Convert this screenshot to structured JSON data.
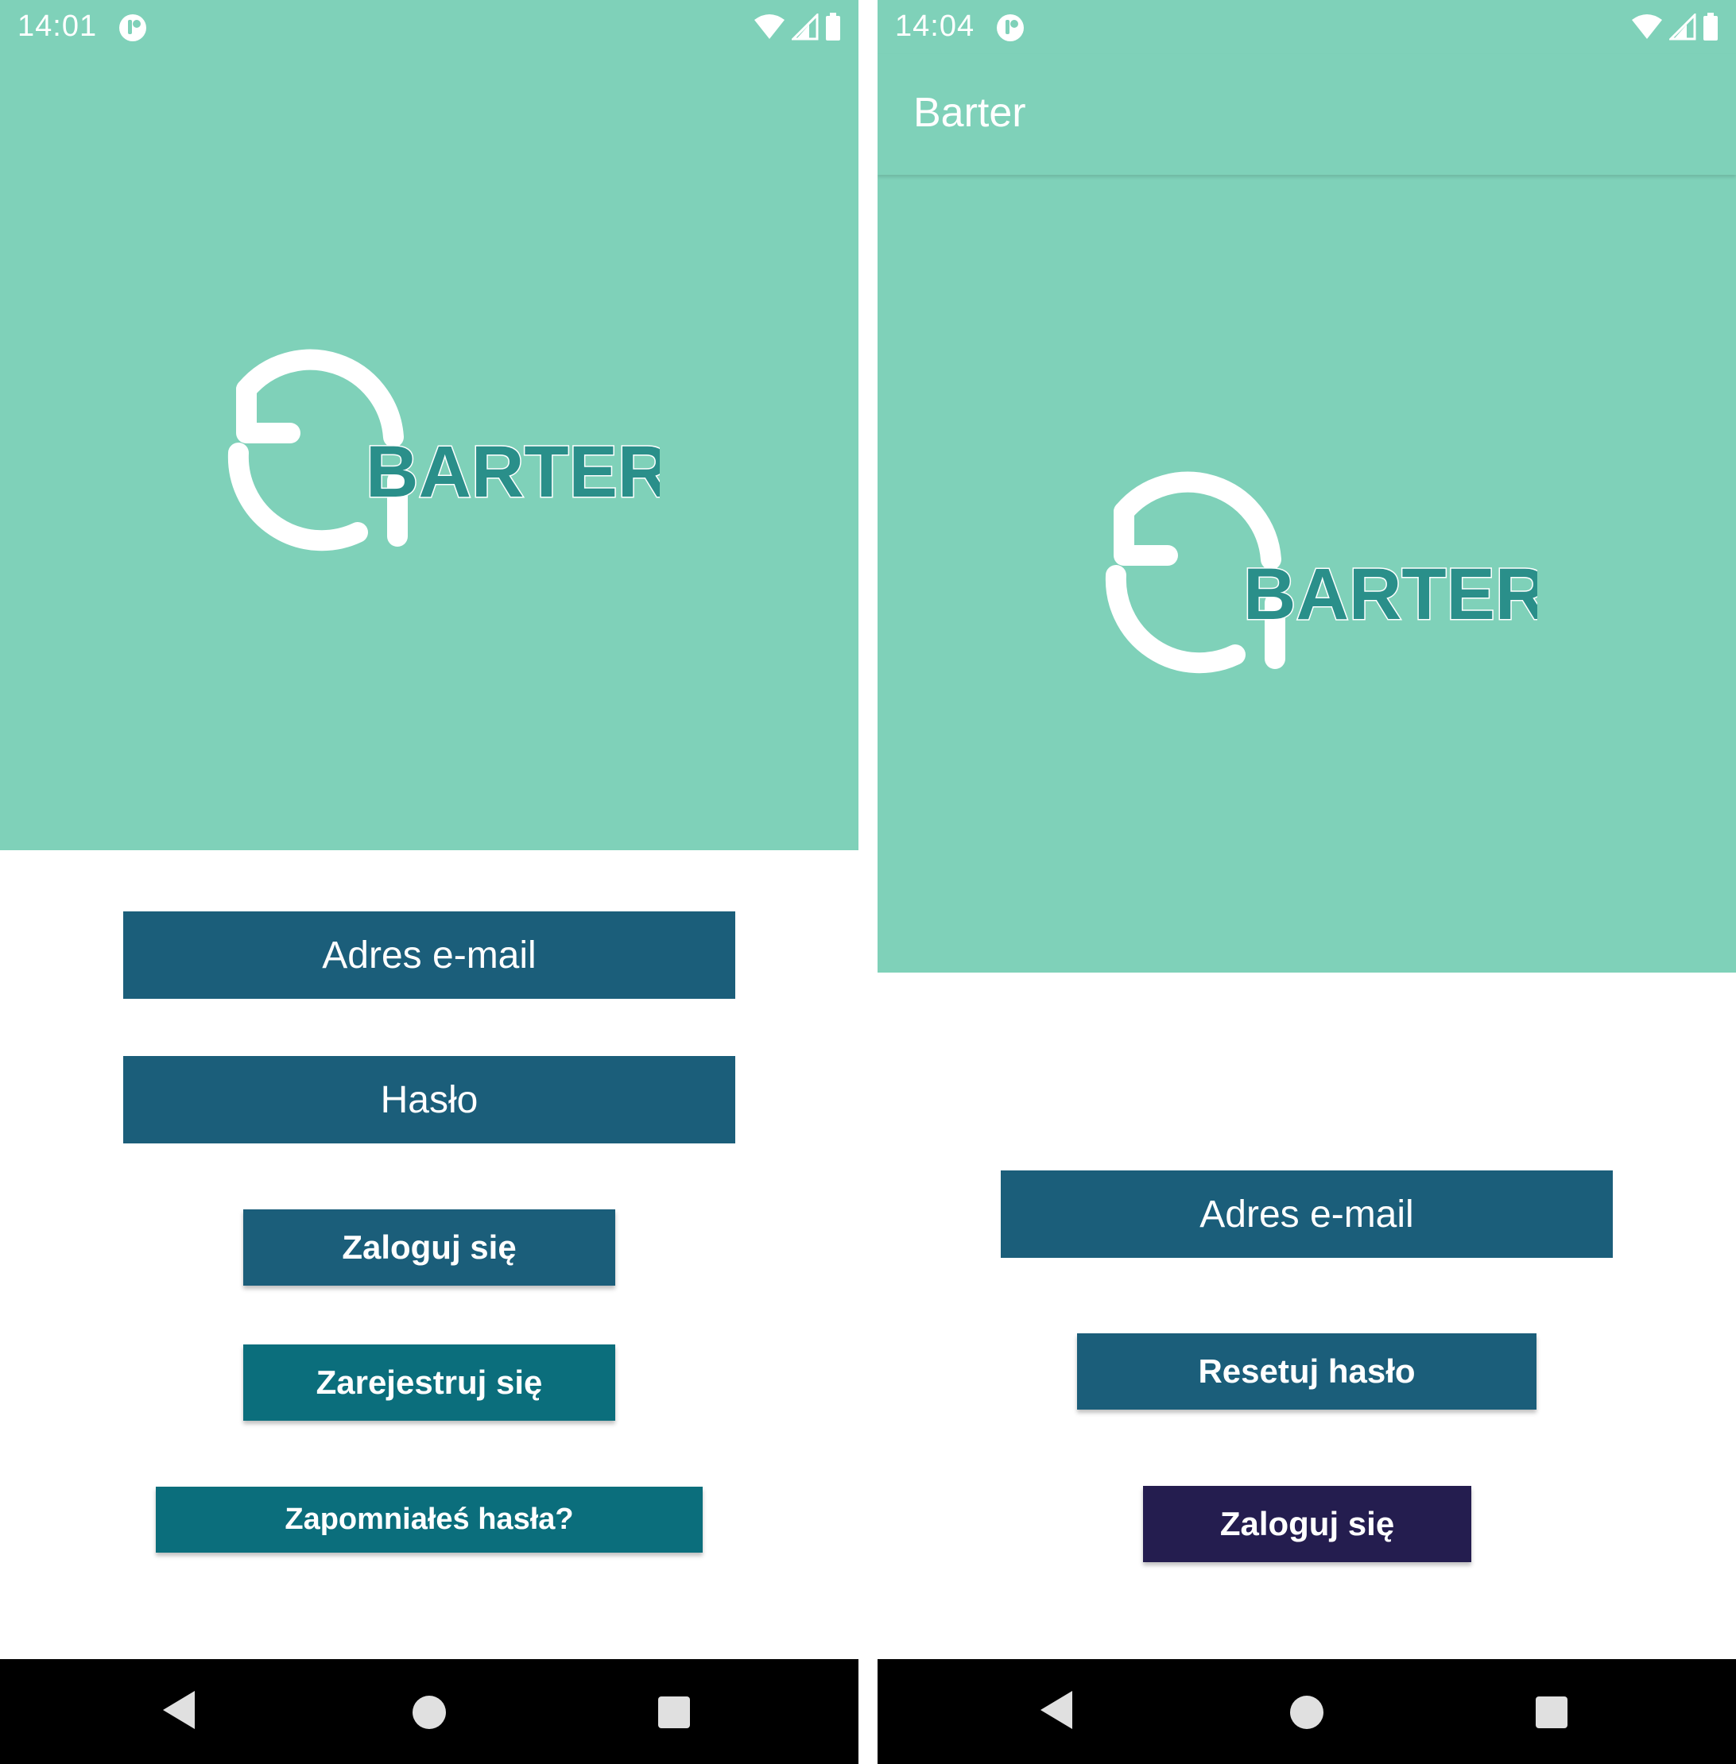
{
  "left": {
    "status": {
      "time": "14:01"
    },
    "logo_text": "BARTER",
    "fields": {
      "email": "Adres e-mail",
      "password": "Hasło"
    },
    "buttons": {
      "login": "Zaloguj się",
      "register": "Zarejestruj się",
      "forgot": "Zapomniałeś hasła?"
    }
  },
  "right": {
    "status": {
      "time": "14:04"
    },
    "appbar": {
      "title": "Barter"
    },
    "logo_text": "BARTER",
    "fields": {
      "email": "Adres e-mail"
    },
    "buttons": {
      "reset": "Resetuj hasło",
      "login": "Zaloguj się"
    }
  },
  "colors": {
    "hero_bg": "#7fd1b9",
    "field_bg": "#1b5e7a",
    "button_blue": "#1b5e7a",
    "button_teal": "#0b6e7c",
    "button_dark": "#241d4f",
    "logo_text": "#2a8f8a"
  },
  "icons": [
    "app-notification-icon",
    "wifi-icon",
    "signal-icon",
    "battery-icon",
    "back-icon",
    "home-icon",
    "recents-icon",
    "sync-arrows-icon"
  ]
}
